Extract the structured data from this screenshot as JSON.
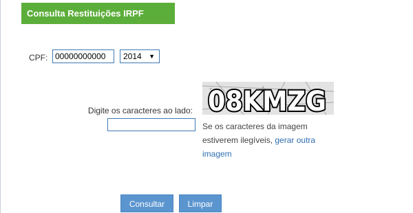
{
  "header": {
    "title": "Consulta Restituições IRPF"
  },
  "form": {
    "cpf_label": "CPF:",
    "cpf_value": "00000000000",
    "year_value": "2014",
    "captcha_label": "Digite os caracteres ao lado:",
    "captcha_value": "",
    "captcha_text": "08KMZG",
    "illegible_prefix": "Se os caracteres da imagem estiverem ilegíveis, ",
    "illegible_link": "gerar outra imagem"
  },
  "buttons": {
    "consultar": "Consultar",
    "limpar": "Limpar"
  },
  "colors": {
    "title_bg": "#5cae3a",
    "button_bg": "#5b95cf",
    "link": "#2f6fb0"
  }
}
